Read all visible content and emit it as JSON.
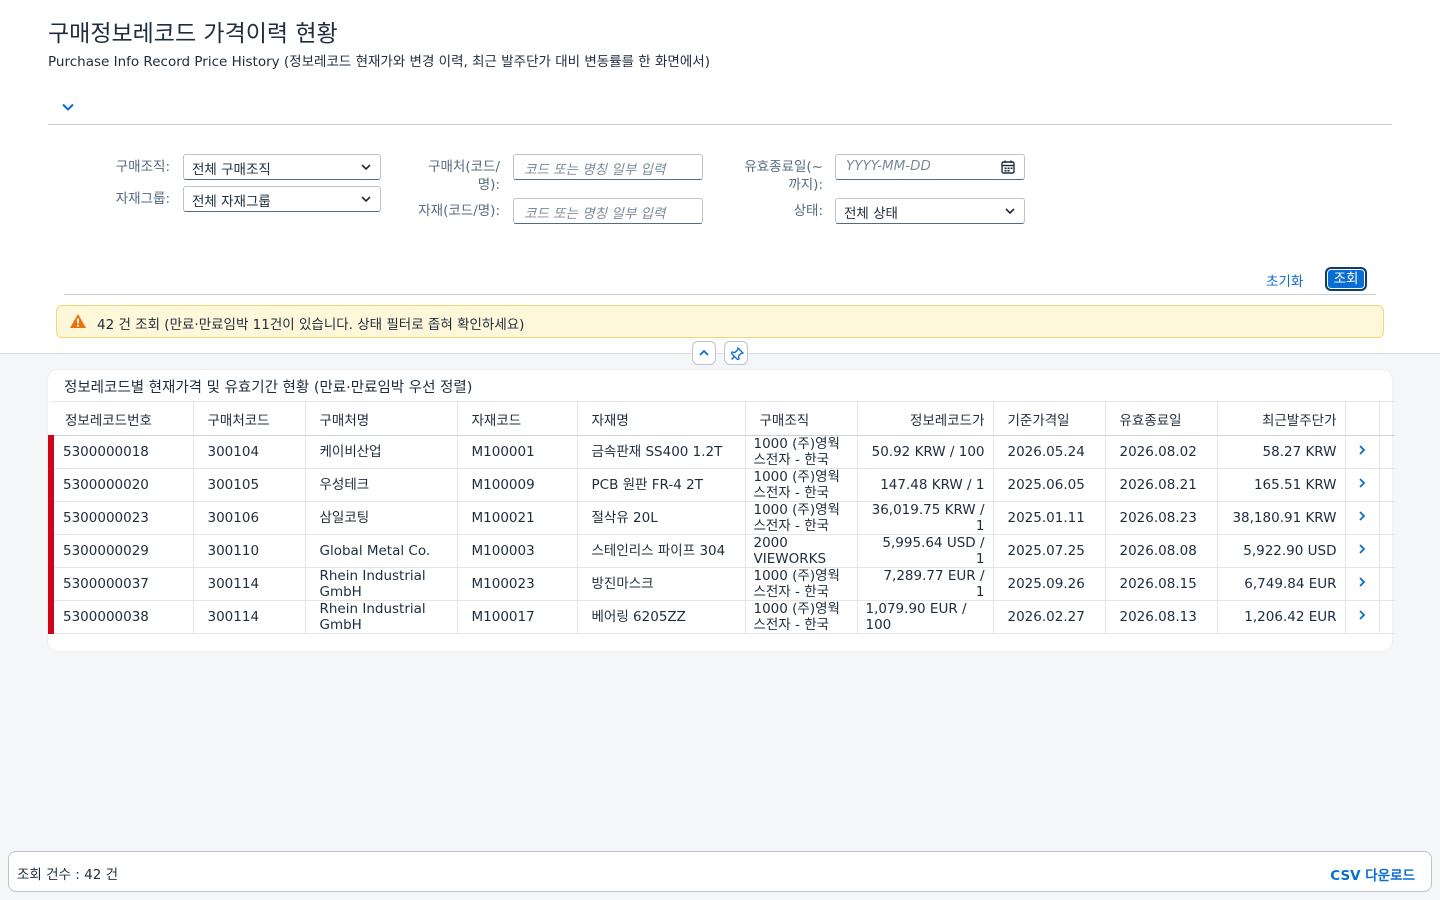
{
  "header": {
    "title": "구매정보레코드 가격이력 현황",
    "subtitle": "Purchase Info Record Price History (정보레코드 현재가와 변경 이력, 최근 발주단가 대비 변동률를 한 화면에서)"
  },
  "filters": {
    "purch_org_label": "구매조직:",
    "purch_org_value": "전체 구매조직",
    "mat_group_label": "자재그룹:",
    "mat_group_value": "전체 자재그룹",
    "vendor_label": "구매처(코드/명):",
    "vendor_placeholder": "코드 또는 명칭 일부 입력",
    "material_label": "자재(코드/명):",
    "material_placeholder": "코드 또는 명칭 일부 입력",
    "valid_to_label": "유효종료일(~까지):",
    "valid_to_placeholder": "YYYY-MM-DD",
    "status_label": "상태:",
    "status_value": "전체 상태",
    "reset_label": "초기화",
    "search_label": "조회"
  },
  "message": {
    "text": "42 건 조회 (만료·만료임박 11건이 있습니다. 상태 필터로 좁혀 확인하세요)",
    "status_color": "#e9730c"
  },
  "table": {
    "title": "정보레코드별 현재가격 및 유효기간 현황 (만료·만료임박 우선 정렬)",
    "columns": [
      "정보레코드번호",
      "구매처코드",
      "구매처명",
      "자재코드",
      "자재명",
      "구매조직",
      "정보레코드가",
      "기준가격일",
      "유효종료일",
      "최근발주단가"
    ],
    "rows": [
      [
        "5300000018",
        "300104",
        "케이비산업",
        "M100001",
        "금속판재 SS400 1.2T",
        "1000 (주)영웍스전자 - 한국",
        "50.92 KRW / 100",
        "2026.05.24",
        "2026.08.02",
        "58.27 KRW"
      ],
      [
        "5300000020",
        "300105",
        "우성테크",
        "M100009",
        "PCB 원판 FR-4 2T",
        "1000 (주)영웍스전자 - 한국",
        "147.48 KRW / 1",
        "2025.06.05",
        "2026.08.21",
        "165.51 KRW"
      ],
      [
        "5300000023",
        "300106",
        "삼일코팅",
        "M100021",
        "절삭유 20L",
        "1000 (주)영웍스전자 - 한국",
        "36,019.75 KRW / 1",
        "2025.01.11",
        "2026.08.23",
        "38,180.91 KRW"
      ],
      [
        "5300000029",
        "300110",
        "Global Metal Co.",
        "M100003",
        "스테인리스 파이프 304",
        "2000 VIEWORKS",
        "5,995.64 USD / 1",
        "2025.07.25",
        "2026.08.08",
        "5,922.90 USD"
      ],
      [
        "5300000037",
        "300114",
        "Rhein Industrial GmbH",
        "M100023",
        "방진마스크",
        "1000 (주)영웍스전자 - 한국",
        "7,289.77 EUR / 1",
        "2025.09.26",
        "2026.08.15",
        "6,749.84 EUR"
      ],
      [
        "5300000038",
        "300114",
        "Rhein Industrial GmbH",
        "M100017",
        "베어링 6205ZZ",
        "1000 (주)영웍스전자 - 한국",
        "1,079.90 EUR / 100",
        "2026.02.27",
        "2026.08.13",
        "1,206.42 EUR"
      ]
    ],
    "status_color": "#d0021b"
  },
  "footer": {
    "count_text": "조회 건수 : 42 건",
    "csv_label": "CSV 다운로드"
  }
}
